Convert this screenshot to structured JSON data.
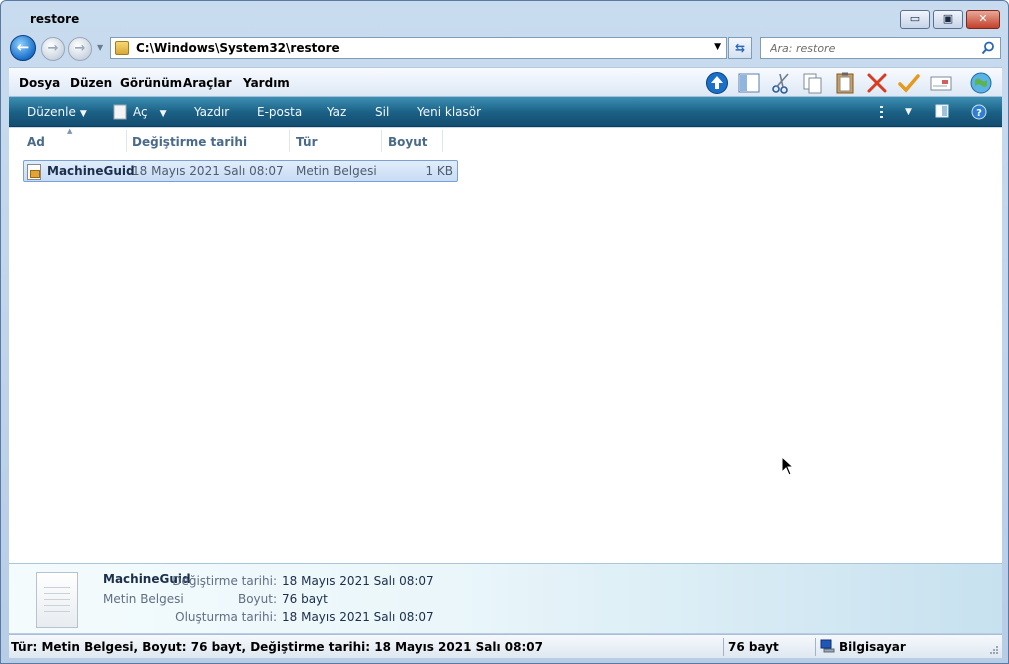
{
  "window": {
    "title": "restore"
  },
  "window_controls": {
    "minimize": "▭",
    "maximize": "▣",
    "close": "✕"
  },
  "navigation": {
    "back_glyph": "←",
    "forward_glyph": "→"
  },
  "address_bar": {
    "path": "C:\\Windows\\System32\\restore"
  },
  "search": {
    "placeholder": "Ara: restore"
  },
  "menu": {
    "items": [
      "Dosya",
      "Düzen",
      "Görünüm",
      "Araçlar",
      "Yardım"
    ]
  },
  "command_bar": {
    "organize": "Düzenle",
    "open": "Aç",
    "print": "Yazdır",
    "email": "E-posta",
    "burn": "Yaz",
    "delete": "Sil",
    "new_folder": "Yeni klasör"
  },
  "columns": {
    "name": "Ad",
    "modified": "Değiştirme tarihi",
    "type": "Tür",
    "size": "Boyut"
  },
  "files": [
    {
      "name": "MachineGuid",
      "modified": "18 Mayıs 2021 Salı 08:07",
      "type": "Metin Belgesi",
      "size": "1 KB"
    }
  ],
  "details_pane": {
    "name": "MachineGuid",
    "type": "Metin Belgesi",
    "modified_label": "Değiştirme tarihi:",
    "modified_value": "18 Mayıs 2021 Salı 08:07",
    "size_label": "Boyut:",
    "size_value": "76 bayt",
    "created_label": "Oluşturma tarihi:",
    "created_value": "18 Mayıs 2021 Salı 08:07"
  },
  "status_bar": {
    "summary": "Tür: Metin Belgesi, Boyut: 76 bayt, Değiştirme tarihi: 18 Mayıs 2021 Salı 08:07",
    "size": "76 bayt",
    "zone": "Bilgisayar"
  },
  "colors": {
    "command_bar": "#1a5f84",
    "selection": "#c8dcf5",
    "column_header_text": "#4a6a8a"
  }
}
